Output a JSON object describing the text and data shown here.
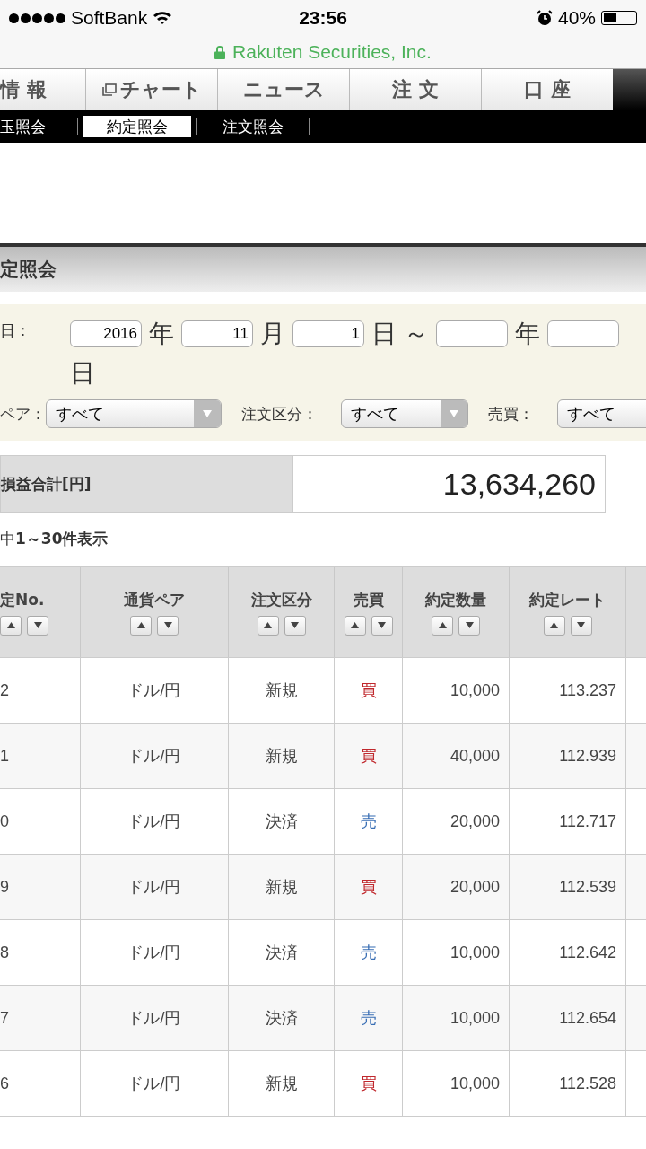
{
  "status_bar": {
    "carrier": "SoftBank",
    "time": "23:56",
    "battery": "40%"
  },
  "url_bar": {
    "site": "Rakuten Securities, Inc."
  },
  "tabs": [
    {
      "label": "情 報",
      "icon": false,
      "selected": false
    },
    {
      "label": "チャート",
      "icon": true,
      "selected": false
    },
    {
      "label": "ニュース",
      "icon": false,
      "selected": false
    },
    {
      "label": "注 文",
      "icon": false,
      "selected": false
    },
    {
      "label": "口 座",
      "icon": false,
      "selected": false
    }
  ],
  "subnav": [
    {
      "label": "玉照会",
      "selected": false
    },
    {
      "label": "約定照会",
      "selected": true
    },
    {
      "label": "注文照会",
      "selected": false
    }
  ],
  "page_title": "定照会",
  "filters": {
    "date_label": "日：",
    "from_year": "2016",
    "year_unit": "年",
    "from_month": "11",
    "month_unit": "月",
    "from_day": "1",
    "day_unit": "日",
    "tilde": "～",
    "to_year_unit": "年",
    "to_day_unit": "日",
    "selects": [
      {
        "label": "ペア：",
        "value": "すべて"
      },
      {
        "label": "注文区分：",
        "value": "すべて"
      },
      {
        "label": "売買：",
        "value": "すべて"
      }
    ]
  },
  "total": {
    "label": "損益合計[円]",
    "value": "13,634,260"
  },
  "count": "中**1～30件表示**",
  "table": {
    "columns": [
      "定No.",
      "通貨ペア",
      "注文区分",
      "売買",
      "約定数量",
      "約定レート"
    ],
    "rows": [
      {
        "no": "2",
        "pair": "ドル/円",
        "type": "新規",
        "side": "買",
        "color": "#c0282d",
        "qty": "10,000",
        "rate": "113.237"
      },
      {
        "no": "1",
        "pair": "ドル/円",
        "type": "新規",
        "side": "買",
        "color": "#c0282d",
        "qty": "40,000",
        "rate": "112.939"
      },
      {
        "no": "0",
        "pair": "ドル/円",
        "type": "決済",
        "side": "売",
        "color": "#3a6fb5",
        "qty": "20,000",
        "rate": "112.717"
      },
      {
        "no": "9",
        "pair": "ドル/円",
        "type": "新規",
        "side": "買",
        "color": "#c0282d",
        "qty": "20,000",
        "rate": "112.539"
      },
      {
        "no": "8",
        "pair": "ドル/円",
        "type": "決済",
        "side": "売",
        "color": "#3a6fb5",
        "qty": "10,000",
        "rate": "112.642"
      },
      {
        "no": "7",
        "pair": "ドル/円",
        "type": "決済",
        "side": "売",
        "color": "#3a6fb5",
        "qty": "10,000",
        "rate": "112.654"
      },
      {
        "no": "6",
        "pair": "ドル/円",
        "type": "新規",
        "side": "買",
        "color": "#c0282d",
        "qty": "10,000",
        "rate": "112.528"
      }
    ]
  }
}
